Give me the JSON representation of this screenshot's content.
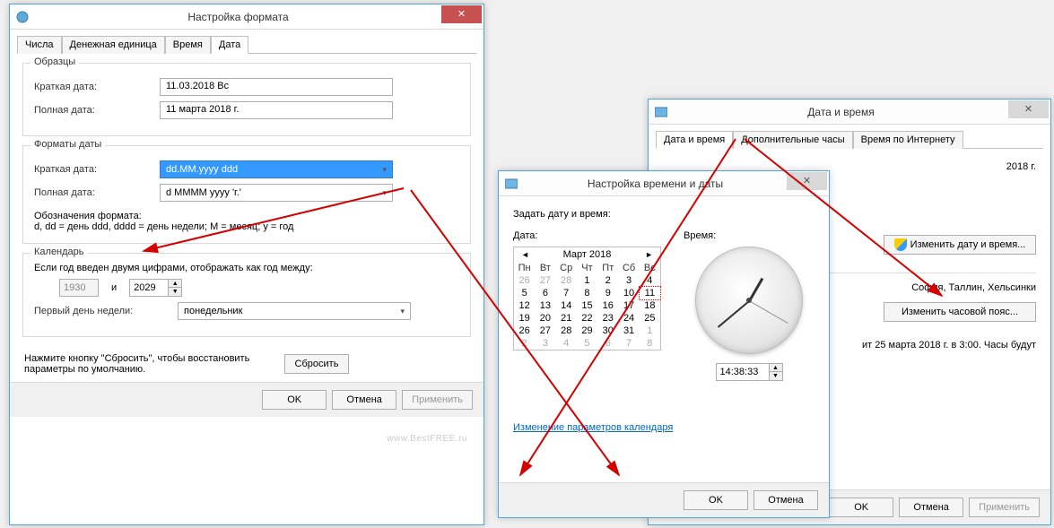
{
  "win1": {
    "title": "Настройка формата",
    "tabs": [
      "Числа",
      "Денежная единица",
      "Время",
      "Дата"
    ],
    "samples": {
      "title": "Образцы",
      "short_label": "Краткая дата:",
      "short_value": "11.03.2018 Вс",
      "long_label": "Полная дата:",
      "long_value": "11 марта 2018 г."
    },
    "formats": {
      "title": "Форматы даты",
      "short_label": "Краткая дата:",
      "short_value": "dd.MM.yyyy ddd",
      "long_label": "Полная дата:",
      "long_value": "d MMMM yyyy 'г.'",
      "legend_label": "Обозначения формата:",
      "legend_text": "d, dd = день  ddd, dddd = день недели; M = месяц; y = год"
    },
    "calendar": {
      "title": "Календарь",
      "range_label": "Если год введен двумя цифрами, отображать как год между:",
      "from": "1930",
      "and": "и",
      "to": "2029",
      "firstday_label": "Первый день недели:",
      "firstday_value": "понедельник"
    },
    "reset_hint": "Нажмите кнопку \"Сбросить\", чтобы восстановить параметры по умолчанию.",
    "reset_btn": "Сбросить",
    "ok": "OK",
    "cancel": "Отмена",
    "apply": "Применить",
    "watermark": "www.BestFREE.ru"
  },
  "win2": {
    "title": "Настройка времени и даты",
    "set_label": "Задать дату и время:",
    "date_label": "Дата:",
    "time_label": "Время:",
    "month": "Март 2018",
    "dow": [
      "Пн",
      "Вт",
      "Ср",
      "Чт",
      "Пт",
      "Сб",
      "Вс"
    ],
    "days": [
      {
        "n": "26",
        "o": true
      },
      {
        "n": "27",
        "o": true
      },
      {
        "n": "28",
        "o": true
      },
      {
        "n": "1"
      },
      {
        "n": "2"
      },
      {
        "n": "3"
      },
      {
        "n": "4"
      },
      {
        "n": "5"
      },
      {
        "n": "6"
      },
      {
        "n": "7"
      },
      {
        "n": "8"
      },
      {
        "n": "9"
      },
      {
        "n": "10"
      },
      {
        "n": "11",
        "sel": true
      },
      {
        "n": "12"
      },
      {
        "n": "13"
      },
      {
        "n": "14"
      },
      {
        "n": "15"
      },
      {
        "n": "16"
      },
      {
        "n": "17"
      },
      {
        "n": "18"
      },
      {
        "n": "19"
      },
      {
        "n": "20"
      },
      {
        "n": "21"
      },
      {
        "n": "22"
      },
      {
        "n": "23"
      },
      {
        "n": "24"
      },
      {
        "n": "25"
      },
      {
        "n": "26"
      },
      {
        "n": "27"
      },
      {
        "n": "28"
      },
      {
        "n": "29"
      },
      {
        "n": "30"
      },
      {
        "n": "31"
      },
      {
        "n": "1",
        "o": true
      },
      {
        "n": "2",
        "o": true
      },
      {
        "n": "3",
        "o": true
      },
      {
        "n": "4",
        "o": true
      },
      {
        "n": "5",
        "o": true
      },
      {
        "n": "6",
        "o": true
      },
      {
        "n": "7",
        "o": true
      },
      {
        "n": "8",
        "o": true
      }
    ],
    "time_value": "14:38:33",
    "link": "Изменение параметров календаря",
    "ok": "OK",
    "cancel": "Отмена"
  },
  "win3": {
    "title": "Дата и время",
    "tabs": [
      "Дата и время",
      "Дополнительные часы",
      "Время по Интернету"
    ],
    "date_text": "2018 г.",
    "change_btn": "Изменить дату и время...",
    "tz_text": "София, Таллин, Хельсинки",
    "change_tz_btn": "Изменить часовой пояс...",
    "dst_text": "ит 25 марта 2018 г. в 3:00. Часы будут",
    "ok": "OK",
    "cancel": "Отмена",
    "apply": "Применить"
  }
}
